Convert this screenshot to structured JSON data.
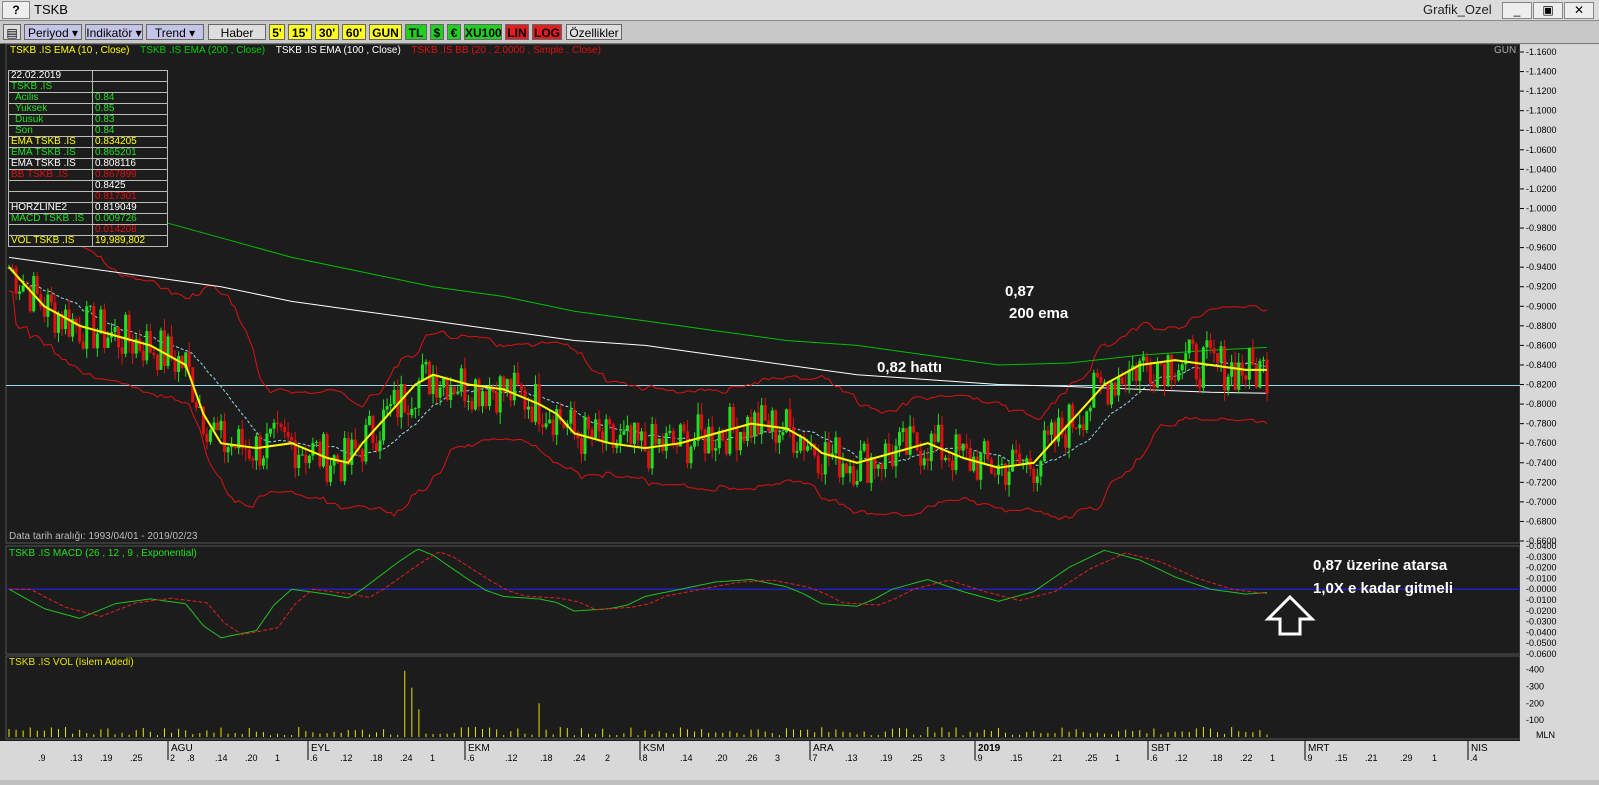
{
  "window": {
    "title": "TSKB",
    "chart_name": "Grafik_Ozel",
    "help": "?",
    "minimize": "_",
    "restore": "▣",
    "close": "✕"
  },
  "toolbar": {
    "periyod": "Periyod",
    "indikator": "Indikatör",
    "trend": "Trend",
    "haber": "Haber",
    "p5": "5'",
    "p15": "15'",
    "p30": "30'",
    "p60": "60'",
    "gun": "GUN",
    "tl": "TL",
    "usd": "$",
    "eur": "€",
    "xu100": "XU100",
    "lin": "LIN",
    "log": "LOG",
    "ozellikler": "Özellikler"
  },
  "legend": {
    "ema10": "TSKB .IS EMA (10 , Close)",
    "ema200": "TSKB .IS EMA (200 , Close)",
    "ema100": "TSKB .IS EMA (100 , Close)",
    "bb": "TSKB .IS BB (20 , 2.0000 , Simple , Close)",
    "period": "GUN"
  },
  "infobox": {
    "date": "22.02.2019",
    "symbol": "TSKB .IS",
    "acilis": {
      "label": "Acilis",
      "value": "0.84"
    },
    "yuksek": {
      "label": "Yuksek",
      "value": "0.85"
    },
    "dusuk": {
      "label": "Dusuk",
      "value": "0.83"
    },
    "son": {
      "label": "Son",
      "value": "0.84"
    },
    "ema1": {
      "label": "EMA TSKB .IS",
      "value": "0.834205"
    },
    "ema2": {
      "label": "EMA TSKB .IS",
      "value": "0.865201"
    },
    "ema3": {
      "label": "EMA TSKB .IS",
      "value": "0.808116"
    },
    "bb": {
      "label": "BB TSKB .IS",
      "v1": "0.867899",
      "v2": "0.8425",
      "v3": "0.817301"
    },
    "horz": {
      "label": "HORZLINE2",
      "value": "0.819049"
    },
    "macd": {
      "label": "MACD TSKB .IS",
      "v1": "0.009726",
      "v2": "0.014208"
    },
    "vol": {
      "label": "VOL TSKB .IS",
      "value": "19,989,802"
    }
  },
  "data_range": "Data tarih aralığı: 1993/04/01 - 2019/02/23",
  "macd_header": "TSKB .IS MACD (26 , 12 , 9 , Exponential)",
  "vol_header": "TSKB .IS VOL (Islem Adedi)",
  "annotations": {
    "a1": "0,87",
    "a2": "200 ema",
    "a3": "0,82 hattı",
    "a4": "0,87 üzerine atarsa",
    "a5": "1,0X e kadar gitmeli"
  },
  "colors": {
    "ema10": "#ffff00",
    "ema200": "#00c000",
    "ema100": "#ffffff",
    "bb": "#e01010",
    "up": "#20e020",
    "down": "#e01010",
    "macd": "#20c020",
    "signal": "#e02020",
    "vol": "#e6e600",
    "hline": "#9ad8e8"
  },
  "chart_data": [
    {
      "type": "candlestick",
      "title": "TSKB",
      "y_ticks": [
        1.16,
        1.14,
        1.12,
        1.1,
        1.08,
        1.06,
        1.04,
        1.02,
        1.0,
        0.98,
        0.96,
        0.94,
        0.92,
        0.9,
        0.88,
        0.86,
        0.84,
        0.82,
        0.8,
        0.78,
        0.76,
        0.74,
        0.72,
        0.7,
        0.68,
        0.66
      ],
      "ylim": [
        0.66,
        1.16
      ],
      "x_month_labels": [
        "AGU",
        "EYL",
        "EKM",
        "KSM",
        "ARA",
        "2019",
        "SBT",
        "MRT",
        "NIS"
      ],
      "x_day_labels": [
        ".9",
        ".13",
        ".19",
        ".25",
        "2",
        ".8",
        ".14",
        ".20",
        "1",
        ".6",
        ".12",
        ".18",
        ".24",
        "1",
        ".6",
        ".12",
        ".18",
        ".24",
        "2",
        ".8",
        ".14",
        ".20",
        ".26",
        "3",
        ".7",
        ".13",
        ".19",
        ".25",
        "3",
        ".9",
        ".15",
        ".21",
        ".25",
        "1",
        ".6",
        ".12",
        ".18",
        ".22",
        "1",
        ".9",
        ".15",
        ".21",
        ".29",
        "1",
        ".4"
      ],
      "horizontal_line": 0.819049,
      "last": {
        "open": 0.84,
        "high": 0.85,
        "low": 0.83,
        "close": 0.84
      },
      "ema10_path": [
        [
          0,
          0.94
        ],
        [
          10,
          0.9
        ],
        [
          20,
          0.88
        ],
        [
          30,
          0.87
        ],
        [
          40,
          0.86
        ],
        [
          50,
          0.84
        ],
        [
          55,
          0.79
        ],
        [
          60,
          0.76
        ],
        [
          70,
          0.755
        ],
        [
          80,
          0.76
        ],
        [
          90,
          0.745
        ],
        [
          96,
          0.74
        ],
        [
          100,
          0.76
        ],
        [
          110,
          0.8
        ],
        [
          115,
          0.82
        ],
        [
          120,
          0.83
        ],
        [
          130,
          0.82
        ],
        [
          140,
          0.815
        ],
        [
          150,
          0.8
        ],
        [
          155,
          0.79
        ],
        [
          160,
          0.77
        ],
        [
          170,
          0.76
        ],
        [
          180,
          0.755
        ],
        [
          190,
          0.76
        ],
        [
          200,
          0.77
        ],
        [
          210,
          0.78
        ],
        [
          220,
          0.775
        ],
        [
          225,
          0.765
        ],
        [
          230,
          0.75
        ],
        [
          240,
          0.74
        ],
        [
          250,
          0.75
        ],
        [
          260,
          0.76
        ],
        [
          270,
          0.745
        ],
        [
          280,
          0.735
        ],
        [
          290,
          0.74
        ],
        [
          300,
          0.78
        ],
        [
          310,
          0.82
        ],
        [
          320,
          0.84
        ],
        [
          330,
          0.845
        ],
        [
          340,
          0.84
        ],
        [
          350,
          0.835
        ],
        [
          356,
          0.835
        ]
      ],
      "ema200_path": [
        [
          0,
          0.95
        ],
        [
          20,
          0.94
        ],
        [
          40,
          0.93
        ],
        [
          60,
          0.92
        ],
        [
          80,
          0.905
        ],
        [
          100,
          0.895
        ],
        [
          120,
          0.885
        ],
        [
          140,
          0.875
        ],
        [
          160,
          0.865
        ],
        [
          180,
          0.86
        ],
        [
          200,
          0.85
        ],
        [
          220,
          0.84
        ],
        [
          240,
          0.83
        ],
        [
          260,
          0.825
        ],
        [
          280,
          0.82
        ],
        [
          300,
          0.818
        ],
        [
          320,
          0.815
        ],
        [
          340,
          0.812
        ],
        [
          356,
          0.811
        ]
      ],
      "ema100_path": [
        [
          0,
          0.99
        ],
        [
          20,
          0.96
        ],
        [
          40,
          0.94
        ],
        [
          60,
          0.92
        ],
        [
          80,
          0.9
        ],
        [
          100,
          0.885
        ],
        [
          120,
          0.87
        ],
        [
          140,
          0.86
        ],
        [
          160,
          0.845
        ],
        [
          180,
          0.835
        ],
        [
          200,
          0.825
        ],
        [
          220,
          0.815
        ],
        [
          240,
          0.81
        ],
        [
          260,
          0.8
        ],
        [
          280,
          0.79
        ],
        [
          300,
          0.792
        ],
        [
          320,
          0.8
        ],
        [
          340,
          0.805
        ],
        [
          356,
          0.808
        ]
      ]
    },
    {
      "type": "line",
      "title": "TSKB .IS MACD (26 , 12 , 9 , Exponential)",
      "ylim": [
        -0.06,
        0.04
      ],
      "y_ticks": [
        0.04,
        0.03,
        0.02,
        0.01,
        0.0,
        -0.01,
        -0.02,
        -0.03,
        -0.04,
        -0.05,
        -0.06
      ],
      "last": {
        "macd": 0.009726,
        "signal": 0.014208
      }
    },
    {
      "type": "bar",
      "title": "TSKB .IS VOL (Islem Adedi)",
      "y_ticks": [
        400,
        300,
        200,
        100
      ],
      "ylabel": "MLN",
      "last": 19989802
    }
  ]
}
